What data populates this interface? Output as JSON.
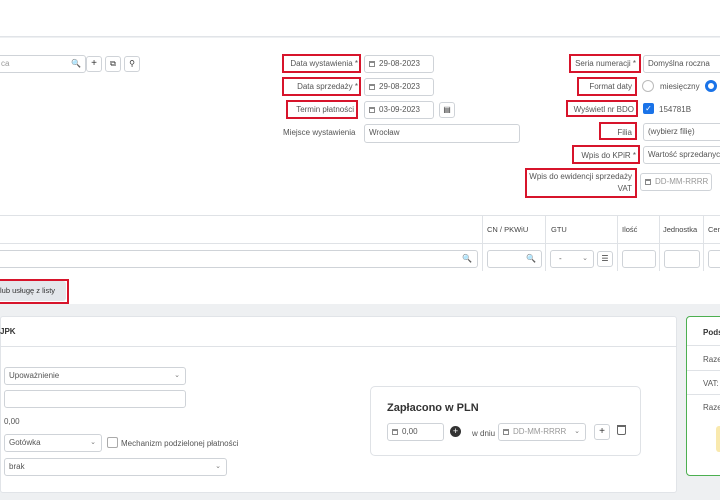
{
  "invoice": {
    "search_placeholder": "ca",
    "date_issue_label": "Data wystawienia *",
    "date_issue_value": "29-08-2023",
    "date_sale_label": "Data sprzedaży *",
    "date_sale_value": "29-08-2023",
    "payment_term_label": "Termin płatności",
    "payment_term_value": "03-09-2023",
    "place_label": "Miejsce wystawienia",
    "place_value": "Wrocław",
    "series_label": "Seria numeracji *",
    "series_value": "Domyślna roczna",
    "date_format_label": "Format daty",
    "date_format_option": "miesięczny",
    "bdo_label": "Wyświetl nr BDO",
    "bdo_value": "154781B",
    "branch_label": "Filia",
    "branch_value": "(wybierz filię)",
    "kpir_label": "Wpis do KPiR *",
    "kpir_value": "Wartość sprzedanych",
    "vat_record_label_1": "Wpis do ewidencji sprzedaży",
    "vat_record_label_2": "VAT",
    "vat_record_placeholder": "DD-MM-RRRR"
  },
  "items_table": {
    "columns": [
      "CN / PKWiU",
      "GTU",
      "Ilość",
      "Jednostka",
      "Cen"
    ],
    "gtu_value": "-",
    "add_from_list_label": "lub usługę z listy"
  },
  "bottom": {
    "tab_label": "JPK",
    "authorization_select": "Upoważnienie",
    "amount_value": "0,00",
    "payment_method": "Gotówka",
    "split_payment_label": "Mechanizm podzielonej płatności",
    "none_select": "brak",
    "paid_title": "Zapłacono w PLN",
    "paid_value": "0,00",
    "paid_on_label": "w dniu",
    "paid_date_placeholder": "DD-MM-RRRR",
    "summary_title": "Pods",
    "summary_row1": "Raze",
    "summary_row2": "VAT:",
    "summary_row3": "Raze"
  },
  "colors": {
    "highlight": "#d7142b",
    "accent": "#1a73e8"
  }
}
